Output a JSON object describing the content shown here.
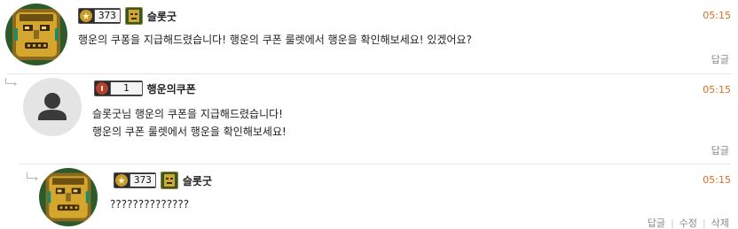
{
  "comments": [
    {
      "level": "373",
      "nick": "슬롯굿",
      "time": "05:15",
      "text": "행운의 쿠퐁을 지급해드렸습니다! 행운의 쿠폰 룰렛에서 행운을 확인해보세요! 있겠어요?",
      "actions": [
        "답글"
      ]
    },
    {
      "level": "1",
      "nick": "행운의쿠폰",
      "time": "05:15",
      "lines": [
        "슬롯굿님 행운의 쿠폰을 지급해드렸습니다!",
        "행운의 쿠폰 룰렛에서 행운을 확인해보세요!"
      ],
      "actions": [
        "답글"
      ]
    },
    {
      "level": "373",
      "nick": "슬롯굿",
      "time": "05:15",
      "text": "??????????????",
      "actions": [
        "답글",
        "수정",
        "삭제"
      ]
    }
  ],
  "colors": {
    "time": "#e06a1e",
    "action": "#888888",
    "badge_dark": "#2b2b2b",
    "gold_icon": "#c79a2b",
    "red_icon": "#b3412c"
  },
  "icons": {
    "totem_avatar": "aztec-totem-icon",
    "default_avatar": "person-silhouette-icon",
    "reply_marker": "reply-arrow-icon"
  }
}
